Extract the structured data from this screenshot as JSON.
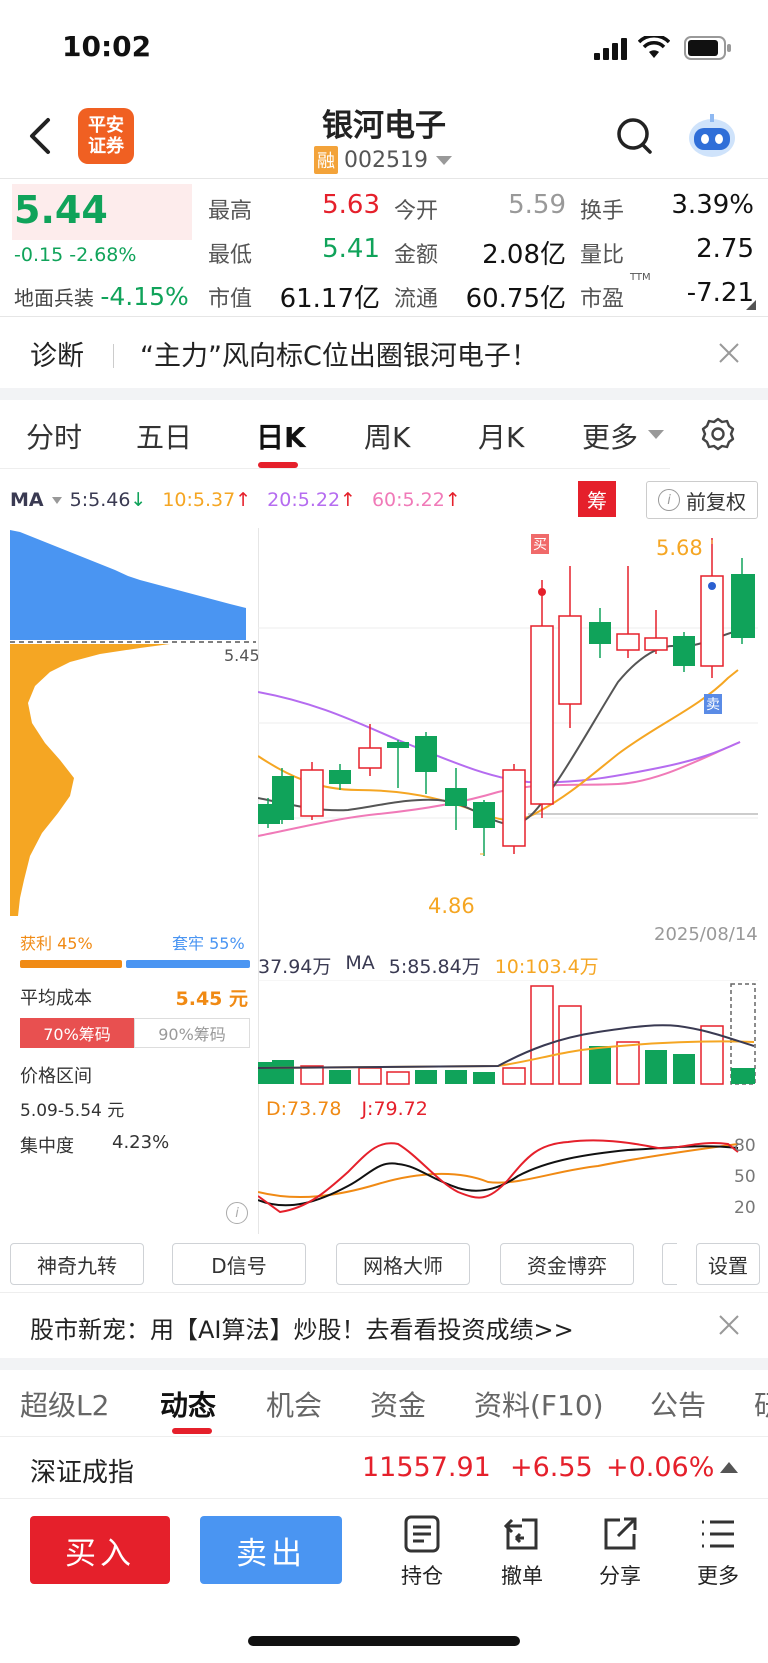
{
  "status_bar": {
    "time": "10:02"
  },
  "header": {
    "broker_logo": "平安\n证券",
    "broker_line1": "平安",
    "broker_line2": "证券",
    "stock_name": "银河电子",
    "margin_badge": "融",
    "stock_code": "002519"
  },
  "quote": {
    "price": "5.44",
    "change": "-0.15",
    "change_pct": "-2.68%",
    "sector_name": "地面兵装",
    "sector_pct": "-4.15%",
    "high_label": "最高",
    "high": "5.63",
    "low_label": "最低",
    "low": "5.41",
    "mktcap_label": "市值",
    "mktcap": "61.17亿",
    "open_label": "今开",
    "open": "5.59",
    "amount_label": "金额",
    "amount": "2.08亿",
    "float_label": "流通",
    "float": "60.75亿",
    "turnover_label": "换手",
    "turnover": "3.39%",
    "volratio_label": "量比",
    "volratio": "2.75",
    "pe_label": "市盈",
    "pe_sup": "TTM",
    "pe": "-7.21"
  },
  "diagnosis": {
    "label": "诊断",
    "text": "“主力”风向标C位出圈银河电子！"
  },
  "chart_tabs": [
    "分时",
    "五日",
    "日K",
    "周K",
    "月K",
    "更多"
  ],
  "active_chart_tab": "日K",
  "ma_legend": {
    "label": "MA",
    "ma5": "5:5.46",
    "ma10": "10:5.37",
    "ma20": "20:5.22",
    "ma60": "60:5.22",
    "chip_badge": "筹",
    "adjust_label": "前复权",
    "colors": {
      "ma5": "#3a3a52",
      "ma10": "#f5a623",
      "ma20": "#b56cf0",
      "ma60": "#f07ab8"
    }
  },
  "chip_panel": {
    "current_price_label": "5.45",
    "profit_label": "获利 45%",
    "locked_label": "套牢 55%",
    "profit_pct": 45,
    "avg_cost_label": "平均成本",
    "avg_cost": "5.45 元",
    "tab70": "70%筹码",
    "tab90": "90%筹码",
    "range_label": "价格区间",
    "range_value": "5.09-5.54 元",
    "concentration_label": "集中度",
    "concentration_value": "4.23%"
  },
  "kline": {
    "high_marker": "5.68",
    "low_marker": "4.86",
    "date": "2025/08/14",
    "buy_marker": "买",
    "sell_marker": "卖"
  },
  "volume": {
    "value": "37.94万",
    "ma_label": "MA",
    "ma5": "5:85.84万",
    "ma10": "10:103.4万"
  },
  "kdj": {
    "d": "D:73.78",
    "j": "J:79.72",
    "levels": [
      "80",
      "50",
      "20"
    ]
  },
  "tool_buttons": [
    "神奇九转",
    "D信号",
    "网格大师",
    "资金博弈",
    "设置"
  ],
  "promo": {
    "text": "股市新宠：用【AI算法】炒股！去看看投资成绩>>"
  },
  "info_tabs": [
    "超级L2",
    "动态",
    "机会",
    "资金",
    "资料(F10)",
    "公告",
    "研"
  ],
  "active_info_tab": "动态",
  "index_bar": {
    "name": "深证成指",
    "value": "11557.91",
    "change": "+6.55",
    "pct": "+0.06%"
  },
  "bottom_bar": {
    "buy": "买入",
    "sell": "卖出",
    "actions": [
      "持仓",
      "撤单",
      "分享",
      "更多"
    ]
  },
  "colors": {
    "up": "#e5202b",
    "down": "#10a35a",
    "accent_blue": "#4a95f2"
  }
}
